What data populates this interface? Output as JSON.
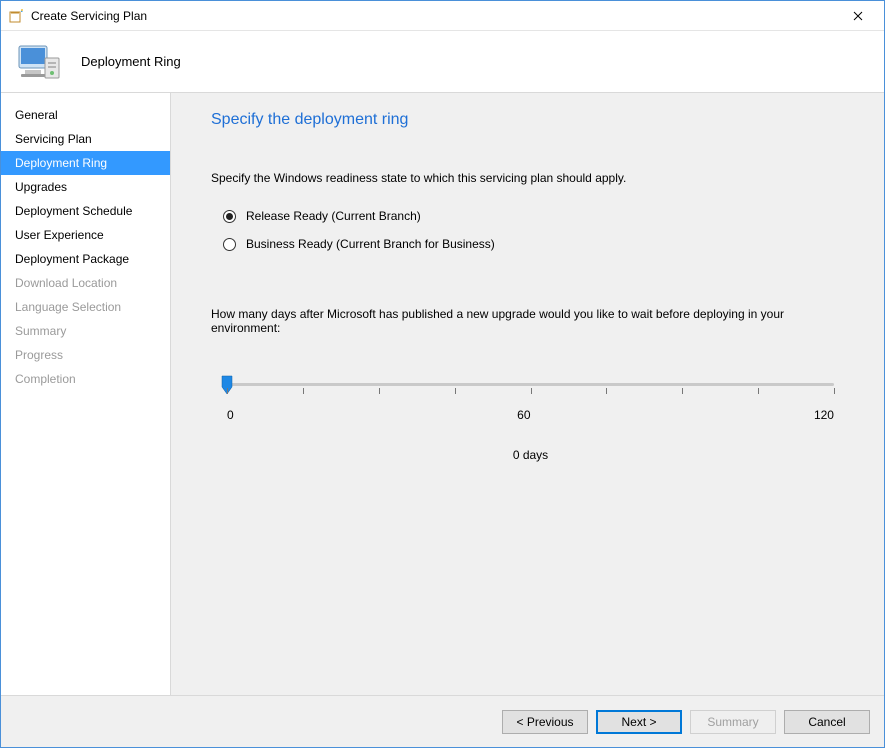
{
  "window": {
    "title": "Create Servicing Plan"
  },
  "header": {
    "title": "Deployment Ring"
  },
  "sidebar": {
    "items": [
      {
        "label": "General",
        "state": "normal"
      },
      {
        "label": "Servicing Plan",
        "state": "normal"
      },
      {
        "label": "Deployment Ring",
        "state": "selected"
      },
      {
        "label": "Upgrades",
        "state": "normal"
      },
      {
        "label": "Deployment Schedule",
        "state": "normal"
      },
      {
        "label": "User Experience",
        "state": "normal"
      },
      {
        "label": "Deployment Package",
        "state": "normal"
      },
      {
        "label": "Download Location",
        "state": "disabled"
      },
      {
        "label": "Language Selection",
        "state": "disabled"
      },
      {
        "label": "Summary",
        "state": "disabled"
      },
      {
        "label": "Progress",
        "state": "disabled"
      },
      {
        "label": "Completion",
        "state": "disabled"
      }
    ]
  },
  "page": {
    "title": "Specify the deployment ring",
    "description": "Specify the Windows readiness state to which this servicing plan should apply.",
    "radios": [
      {
        "label": "Release Ready (Current Branch)",
        "selected": true
      },
      {
        "label": "Business Ready (Current Branch for Business)",
        "selected": false
      }
    ],
    "question": "How many days after Microsoft has published a new upgrade would you like to wait before deploying in your environment:",
    "slider": {
      "min_label": "0",
      "mid_label": "60",
      "max_label": "120",
      "value_label": "0 days",
      "value": 0,
      "min": 0,
      "max": 120
    }
  },
  "footer": {
    "previous": "< Previous",
    "next": "Next >",
    "summary": "Summary",
    "cancel": "Cancel"
  }
}
